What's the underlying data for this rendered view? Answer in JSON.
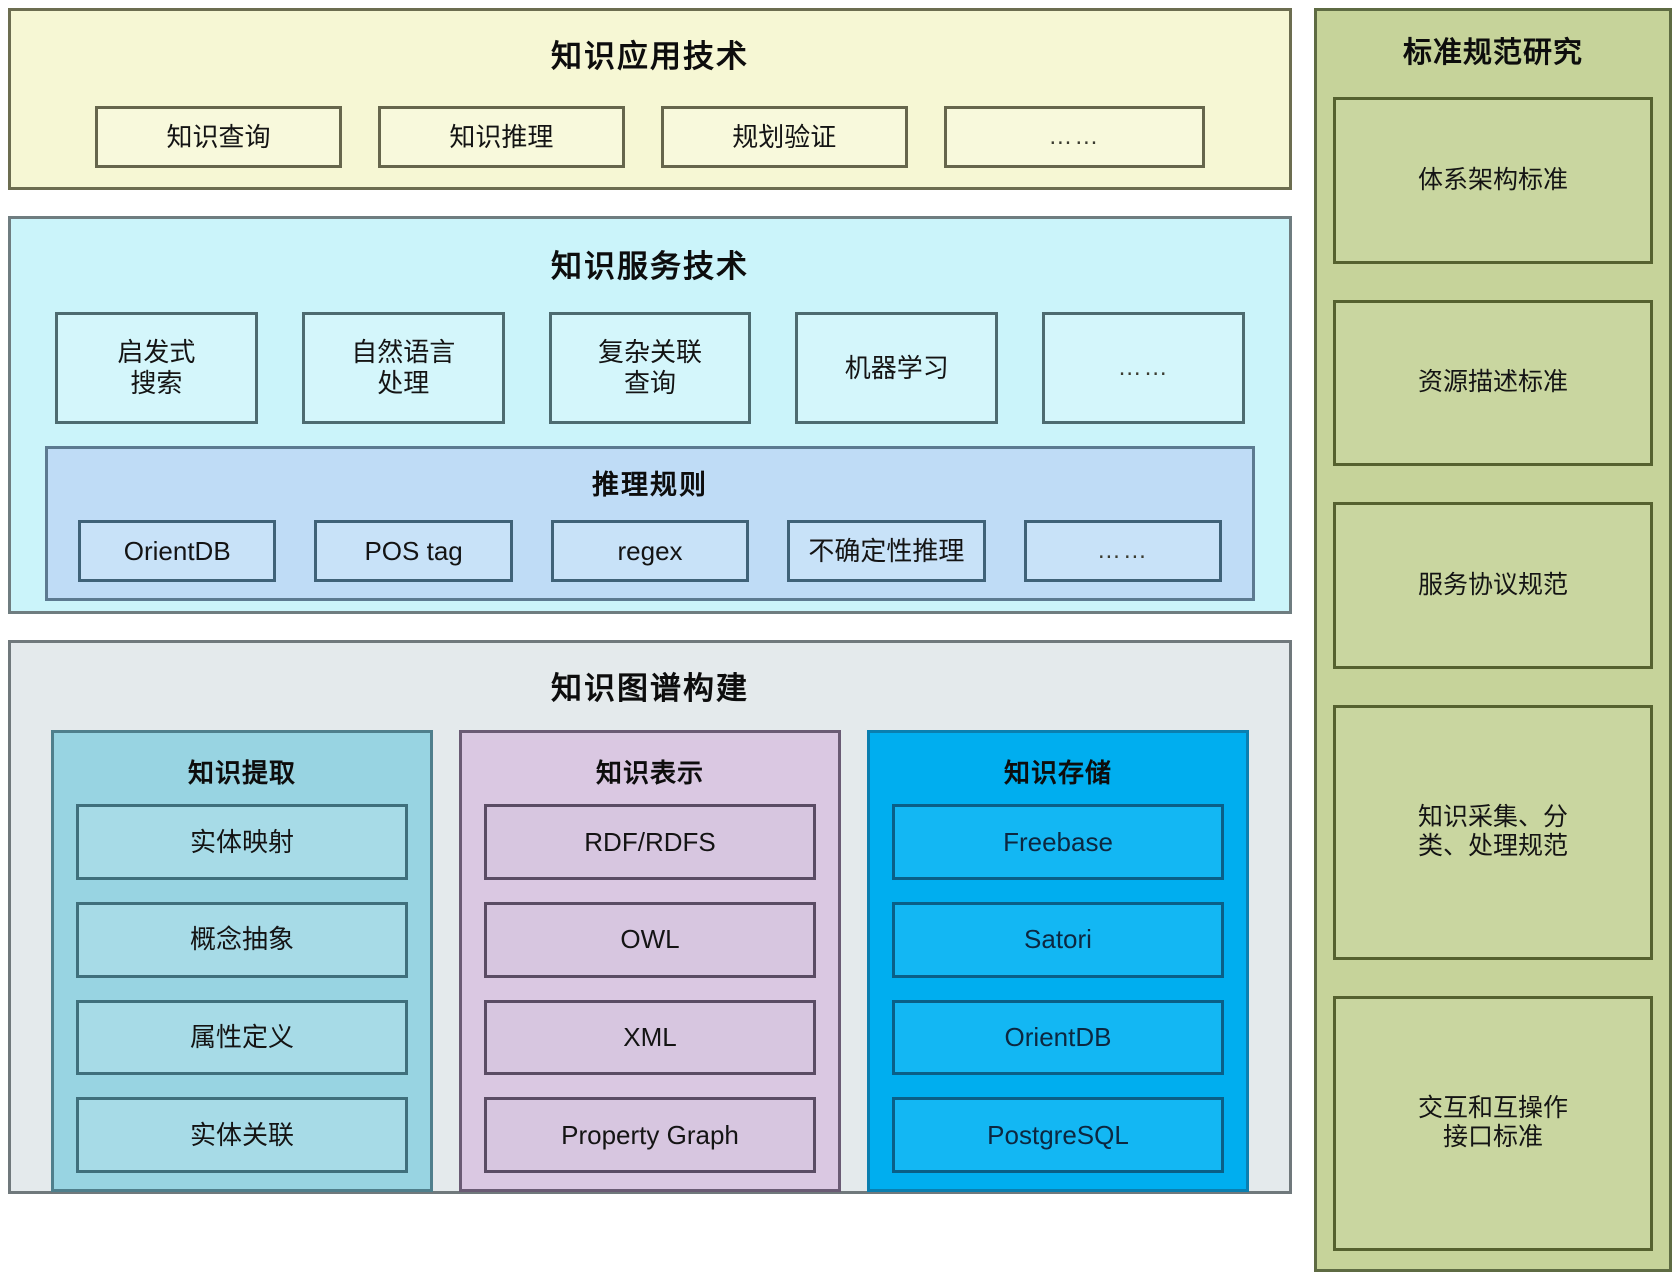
{
  "application_layer": {
    "title": "知识应用技术",
    "items": [
      {
        "label": "知识查询"
      },
      {
        "label": "知识推理"
      },
      {
        "label": "规划验证"
      },
      {
        "label": "……"
      }
    ]
  },
  "service_layer": {
    "title": "知识服务技术",
    "items": [
      {
        "label": "启发式\n搜索"
      },
      {
        "label": "自然语言\n处理"
      },
      {
        "label": "复杂关联\n查询"
      },
      {
        "label": "机器学习"
      },
      {
        "label": "……"
      }
    ],
    "rules": {
      "title": "推理规则",
      "items": [
        {
          "label": "OrientDB"
        },
        {
          "label": "POS tag"
        },
        {
          "label": "regex"
        },
        {
          "label": "不确定性推理"
        },
        {
          "label": "……"
        }
      ]
    }
  },
  "graph_layer": {
    "title": "知识图谱构建",
    "columns": [
      {
        "title": "知识提取",
        "items": [
          {
            "label": "实体映射"
          },
          {
            "label": "概念抽象"
          },
          {
            "label": "属性定义"
          },
          {
            "label": "实体关联"
          }
        ]
      },
      {
        "title": "知识表示",
        "items": [
          {
            "label": "RDF/RDFS"
          },
          {
            "label": "OWL"
          },
          {
            "label": "XML"
          },
          {
            "label": "Property Graph"
          }
        ]
      },
      {
        "title": "知识存储",
        "items": [
          {
            "label": "Freebase"
          },
          {
            "label": "Satori"
          },
          {
            "label": "OrientDB"
          },
          {
            "label": "PostgreSQL"
          }
        ]
      }
    ]
  },
  "standards_layer": {
    "title": "标准规范研究",
    "items": [
      {
        "label": "体系架构标准"
      },
      {
        "label": "资源描述标准"
      },
      {
        "label": "服务协议规范"
      },
      {
        "label": "知识采集、分\n类、处理规范"
      },
      {
        "label": "交互和互操作\n接口标准"
      }
    ]
  },
  "colors": {
    "application": "#f6f7d4",
    "service": "#cbf4fa",
    "rules": "#bfdcf6",
    "graph": "#e4eaec",
    "extract": "#98d4e2",
    "represent": "#dac8e2",
    "store": "#00aeef",
    "standards": "#c6d39a"
  }
}
